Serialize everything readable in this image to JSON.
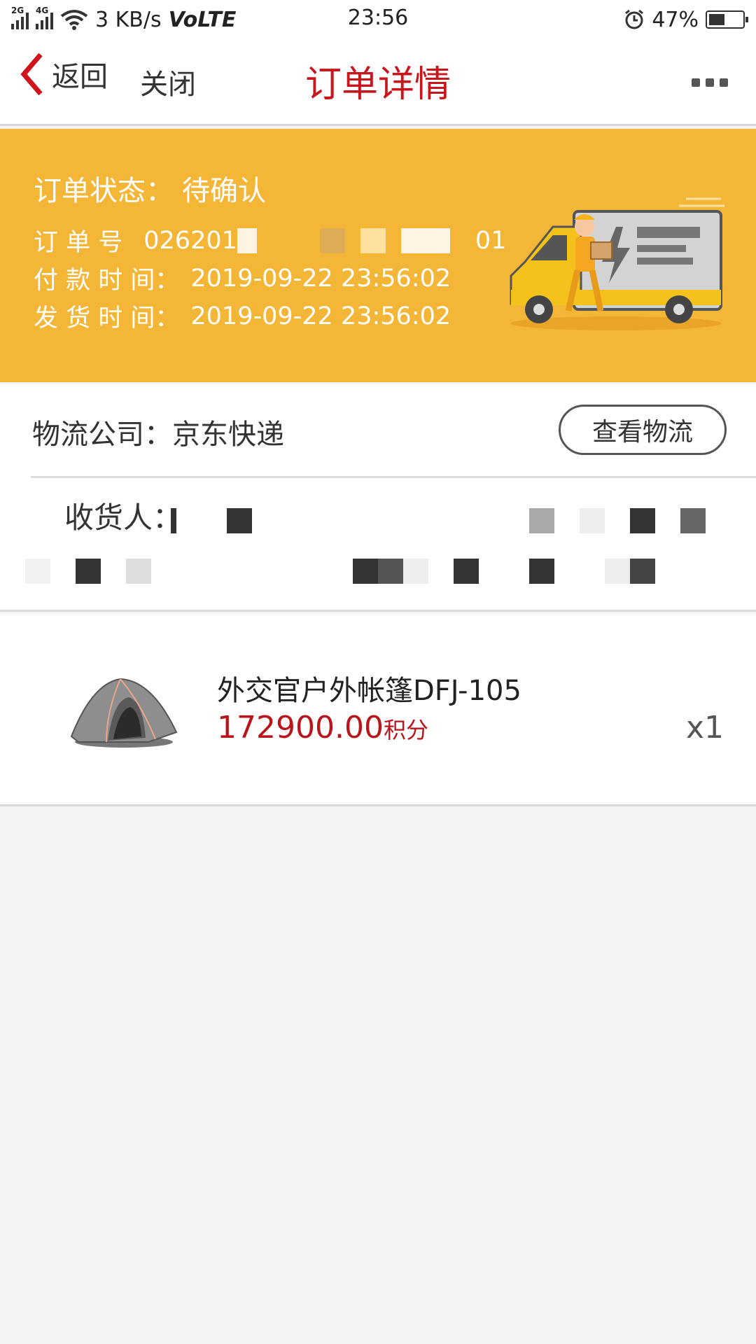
{
  "status_bar": {
    "net1": "2G",
    "net2": "4G",
    "speed": "3 KB/s",
    "volte": "VoLTE",
    "time": "23:56",
    "battery": "47%",
    "battery_level": 0.47
  },
  "nav": {
    "back_label": "返回",
    "close_label": "关闭",
    "title": "订单详情",
    "more_icon": "more-dots-icon"
  },
  "order": {
    "status_label": "订单状态：",
    "status_value": "待确认",
    "number_label": "订 单 号",
    "number_prefix": "026201",
    "number_suffix": "01",
    "pay_time_label": "付 款 时 间：",
    "pay_time": "2019-09-22 23:56:02",
    "ship_time_label": "发 货 时 间：",
    "ship_time": "2019-09-22 23:56:02",
    "illustration": "delivery-truck-illustration"
  },
  "logistics": {
    "company_label": "物流公司：",
    "company": "京东快递",
    "track_button": "查看物流",
    "receiver_label": "收货人："
  },
  "product": {
    "name": "外交官户外帐篷DFJ-105",
    "price": "172900.00",
    "price_unit": "积分",
    "quantity": "x1",
    "image": "tent-image"
  },
  "colors": {
    "accent_red": "#c8161d",
    "banner": "#f4b636"
  }
}
